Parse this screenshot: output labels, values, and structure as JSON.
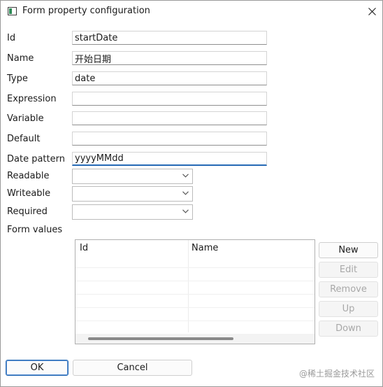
{
  "window": {
    "title": "Form property configuration",
    "close_icon": "close-icon"
  },
  "fields": [
    {
      "label": "Id",
      "value": "startDate"
    },
    {
      "label": "Name",
      "value": "开始日期"
    },
    {
      "label": "Type",
      "value": "date"
    },
    {
      "label": "Expression",
      "value": ""
    },
    {
      "label": "Variable",
      "value": ""
    },
    {
      "label": "Default",
      "value": ""
    },
    {
      "label": "Date pattern",
      "value": "yyyyMMdd"
    }
  ],
  "combos": [
    {
      "label": "Readable",
      "value": ""
    },
    {
      "label": "Writeable",
      "value": ""
    },
    {
      "label": "Required",
      "value": ""
    }
  ],
  "form_values": {
    "label": "Form values",
    "columns": [
      "Id",
      "Name"
    ]
  },
  "side_buttons": [
    {
      "label": "New",
      "enabled": true
    },
    {
      "label": "Edit",
      "enabled": false
    },
    {
      "label": "Remove",
      "enabled": false
    },
    {
      "label": "Up",
      "enabled": false
    },
    {
      "label": "Down",
      "enabled": false
    }
  ],
  "footer": {
    "ok_label": "OK",
    "cancel_label": "Cancel"
  },
  "watermark": "@稀土掘金技术社区",
  "colors": {
    "focus_accent": "#2569b5",
    "disabled_text": "#a8a8a8"
  }
}
